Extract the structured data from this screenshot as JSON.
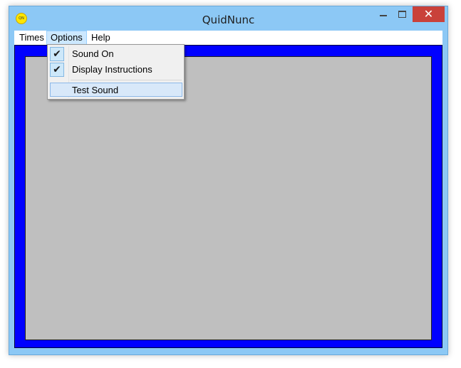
{
  "window": {
    "title": "QuidNunc",
    "icon_text": "QN",
    "close_glyph": "✕"
  },
  "menubar": {
    "items": [
      {
        "label": "Times"
      },
      {
        "label": "Options"
      },
      {
        "label": "Help"
      }
    ]
  },
  "options_menu": {
    "items": [
      {
        "label": "Sound On",
        "checked": true,
        "check_glyph": "✔"
      },
      {
        "label": "Display Instructions",
        "checked": true,
        "check_glyph": "✔"
      },
      {
        "label": "Test Sound",
        "checked": false
      }
    ]
  },
  "colors": {
    "frame_blue": "#0000ff",
    "board_gray": "#bfbfbf",
    "close_red": "#c9413a",
    "title_bar": "#8cc8f5"
  }
}
